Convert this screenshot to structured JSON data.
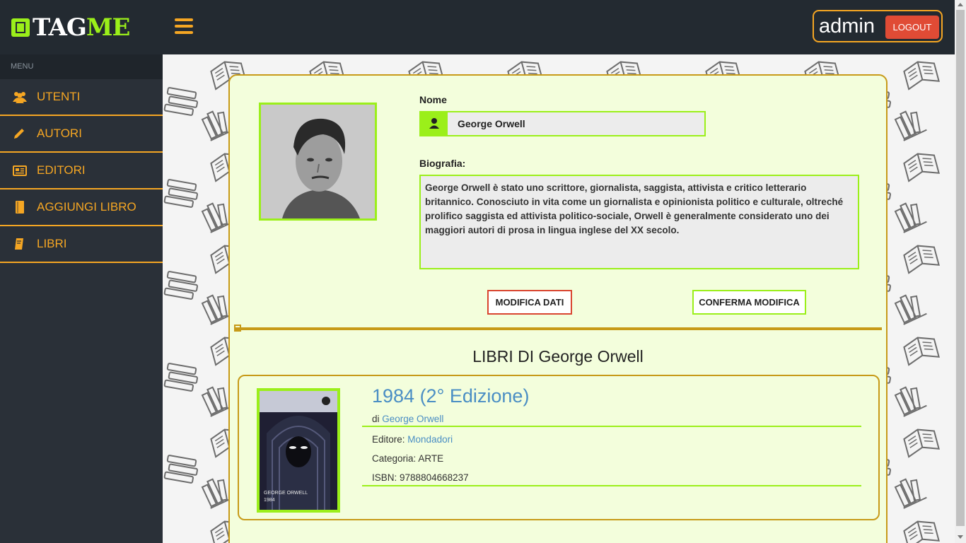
{
  "header": {
    "logo_tag": "TAG",
    "logo_me": "ME",
    "username": "admin",
    "logout_label": "LOGOUT"
  },
  "sidebar": {
    "menu_header": "MENU",
    "items": [
      {
        "label": "UTENTI",
        "icon": "users-icon"
      },
      {
        "label": "AUTORI",
        "icon": "pencil-icon"
      },
      {
        "label": "EDITORI",
        "icon": "newspaper-icon"
      },
      {
        "label": "AGGIUNGI LIBRO",
        "icon": "book-icon"
      },
      {
        "label": "LIBRI",
        "icon": "book-open-icon"
      }
    ]
  },
  "author": {
    "name_label": "Nome",
    "name": "George Orwell",
    "bio_label": "Biografia:",
    "bio": "George Orwell è stato uno scrittore, giornalista, saggista, attivista e critico letterario britannico. Conosciuto in vita come un giornalista e opinionista politico e culturale, oltreché prolifico saggista ed attivista politico-sociale, Orwell è generalmente considerato uno dei maggiori autori di prosa in lingua inglese del XX secolo.",
    "edit_button": "MODIFICA DATI",
    "confirm_button": "CONFERMA MODIFICA"
  },
  "books": {
    "section_title": "LIBRI DI George Orwell",
    "items": [
      {
        "title": "1984 (2° Edizione)",
        "by_prefix": "di",
        "author": "George Orwell",
        "publisher_label": "Editore:",
        "publisher": "Mondadori",
        "category_label": "Categoria:",
        "category": "ARTE",
        "isbn_label": "ISBN:",
        "isbn": "9788804668237",
        "cover_author": "GEORGE ORWELL",
        "cover_title": "1984"
      }
    ]
  },
  "colors": {
    "accent_orange": "#f5a623",
    "accent_green": "#9bef1a",
    "logout_red": "#e04b35",
    "card_bg": "#f3fedc",
    "card_border": "#c79a18",
    "link_blue": "#4a8ec4"
  }
}
